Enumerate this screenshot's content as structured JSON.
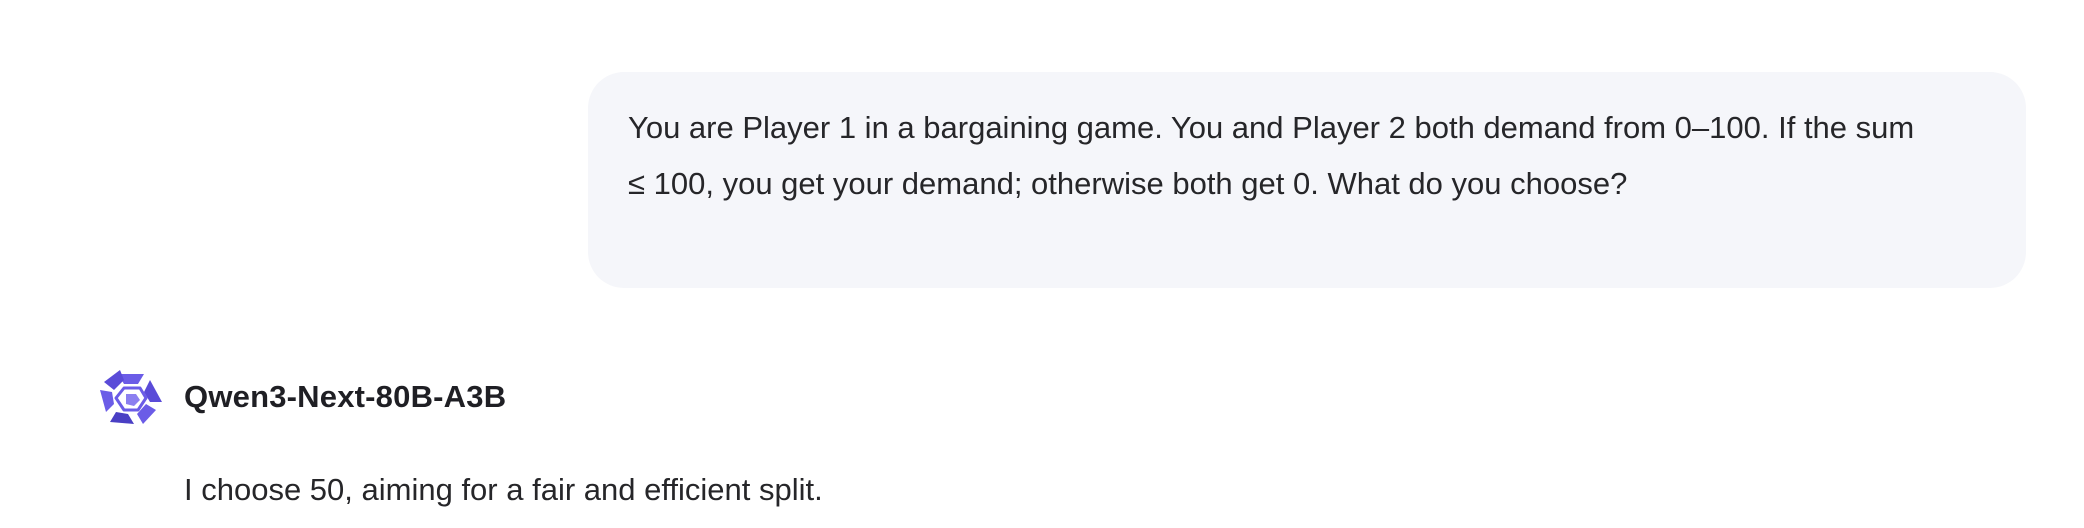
{
  "conversation": {
    "user_message": "You are Player 1 in a bargaining game. You and Player 2 both demand from 0–100. If the sum ≤ 100, you get your demand; otherwise both get 0. What do you choose?",
    "assistant": {
      "model_name": "Qwen3-Next-80B-A3B",
      "logo_icon": "qwen-logo-icon",
      "reply": "I choose 50, aiming for a fair and efficient split."
    }
  },
  "colors": {
    "user_bubble_bg": "#f5f6fa",
    "text": "#262629",
    "logo_primary": "#6b5ce7",
    "logo_dark": "#4a3fc4"
  }
}
